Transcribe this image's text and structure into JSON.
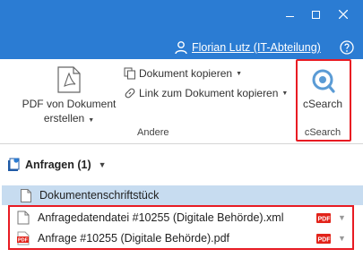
{
  "user": {
    "name": "Florian Lutz (IT-Abteilung)"
  },
  "ribbon": {
    "pdf_button": {
      "line1": "PDF von Dokument",
      "line2": "erstellen"
    },
    "copy_document": "Dokument kopieren",
    "copy_link": "Link zum Dokument kopieren",
    "group_andere": "Andere",
    "csearch_button": "cSearch",
    "csearch_group": "cSearch"
  },
  "section": {
    "title": "Anfragen (1)"
  },
  "list": {
    "header": "Dokumentenschriftstück",
    "items": [
      {
        "name": "Anfragedatendatei #10255 (Digitale Behörde).xml",
        "icon": "doc-icon"
      },
      {
        "name": "Anfrage #10255 (Digitale Behörde).pdf",
        "icon": "pdf-icon"
      }
    ]
  },
  "colors": {
    "titlebar": "#2b7cd3",
    "highlight": "#e81b23",
    "list_header": "#c7dcf0",
    "pdf_red": "#e2231a"
  }
}
